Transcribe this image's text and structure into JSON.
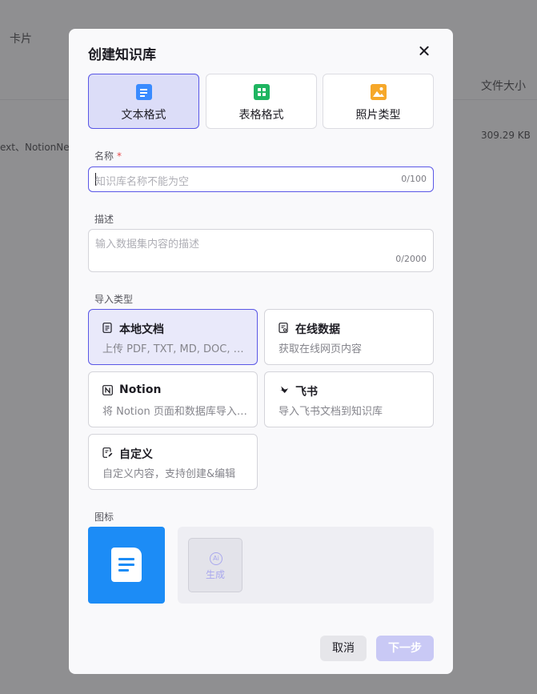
{
  "background": {
    "tab_label": "卡片",
    "column_header": "文件大小",
    "row_sources_text": "ext、NotionNex",
    "row_size": "309.29 KB"
  },
  "modal": {
    "title": "创建知识库",
    "formats": [
      {
        "label": "文本格式",
        "icon": "document-icon",
        "selected": true
      },
      {
        "label": "表格格式",
        "icon": "table-icon",
        "selected": false
      },
      {
        "label": "照片类型",
        "icon": "image-icon",
        "selected": false
      }
    ],
    "name_field": {
      "label": "名称",
      "required_mark": "*",
      "placeholder": "知识库名称不能为空",
      "counter": "0/100"
    },
    "desc_field": {
      "label": "描述",
      "placeholder": "输入数据集内容的描述",
      "counter": "0/2000"
    },
    "import_type": {
      "label": "导入类型",
      "options": [
        {
          "title": "本地文档",
          "desc": "上传 PDF, TXT, MD, DOC, DOCX 格式的本地文件",
          "icon": "file-icon",
          "selected": true
        },
        {
          "title": "在线数据",
          "desc": "获取在线网页内容",
          "icon": "web-file-icon",
          "selected": false
        },
        {
          "title": "Notion",
          "desc": "将 Notion 页面和数据库导入到知识库",
          "icon": "notion-icon",
          "selected": false
        },
        {
          "title": "飞书",
          "desc": "导入飞书文档到知识库",
          "icon": "feishu-icon",
          "selected": false
        },
        {
          "title": "自定义",
          "desc": "自定义内容，支持创建&编辑",
          "icon": "edit-file-icon",
          "selected": false
        }
      ]
    },
    "icon_section": {
      "label": "图标",
      "ai_badge": "Ai",
      "generate_label": "生成"
    },
    "buttons": {
      "cancel": "取消",
      "next": "下一步"
    },
    "colors": {
      "accent": "#5a57e6",
      "icon_blue": "#1c8cf6",
      "next_disabled": "#c9c9f5"
    }
  }
}
